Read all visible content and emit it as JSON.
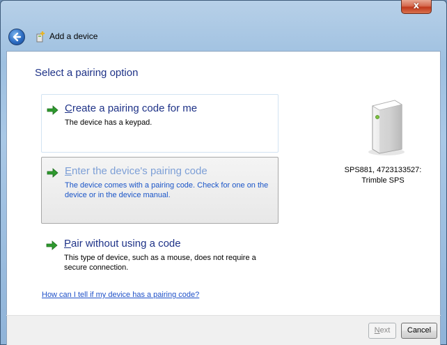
{
  "window": {
    "title": "Add a device",
    "close_glyph": "x"
  },
  "page": {
    "heading": "Select a pairing option"
  },
  "options": [
    {
      "title_first": "C",
      "title_rest": "reate a pairing code for me",
      "description": "The device has a keypad."
    },
    {
      "title_first": "E",
      "title_rest": "nter the device's pairing code",
      "description": "The device comes with a pairing code. Check for one on the device or in the device manual."
    },
    {
      "title_first": "P",
      "title_rest": "air without using a code",
      "description": "This type of device, such as a mouse, does not require a secure connection."
    }
  ],
  "help_link": "How can I tell if my device has a pairing code?",
  "device": {
    "name_line1": "SPS881, 4723133527:",
    "name_line2": "Trimble SPS",
    "icon": "device-tower-icon"
  },
  "buttons": {
    "next_first": "N",
    "next_rest": "ext",
    "cancel": "Cancel"
  },
  "colors": {
    "link_blue": "#1e3287",
    "arrow_green": "#2e9a2e"
  }
}
